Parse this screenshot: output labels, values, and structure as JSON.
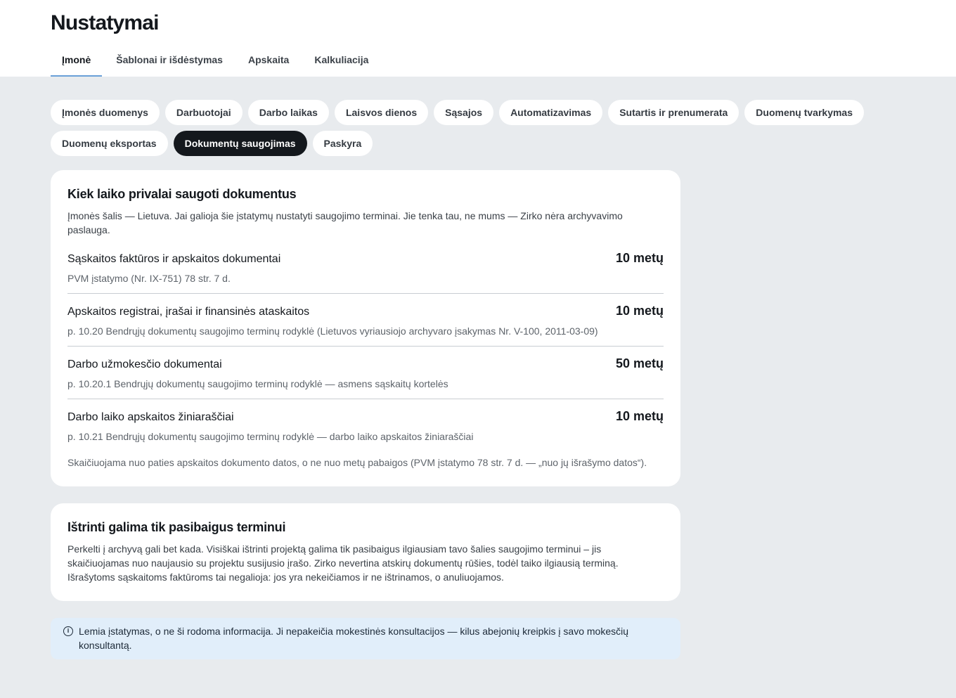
{
  "header": {
    "title": "Nustatymai",
    "tabs": [
      {
        "label": "Įmonė",
        "active": true
      },
      {
        "label": "Šablonai ir išdėstymas",
        "active": false
      },
      {
        "label": "Apskaita",
        "active": false
      },
      {
        "label": "Kalkuliacija",
        "active": false
      }
    ]
  },
  "subnav": {
    "pills": [
      {
        "label": "Įmonės duomenys",
        "active": false
      },
      {
        "label": "Darbuotojai",
        "active": false
      },
      {
        "label": "Darbo laikas",
        "active": false
      },
      {
        "label": "Laisvos dienos",
        "active": false
      },
      {
        "label": "Sąsajos",
        "active": false
      },
      {
        "label": "Automatizavimas",
        "active": false
      },
      {
        "label": "Sutartis ir prenumerata",
        "active": false
      },
      {
        "label": "Duomenų tvarkymas",
        "active": false
      },
      {
        "label": "Duomenų eksportas",
        "active": false
      },
      {
        "label": "Dokumentų saugojimas",
        "active": true
      },
      {
        "label": "Paskyra",
        "active": false
      }
    ]
  },
  "retention": {
    "title": "Kiek laiko privalai saugoti dokumentus",
    "description": "Įmonės šalis — Lietuva. Jai galioja šie įstatymų nustatyti saugojimo terminai. Jie tenka tau, ne mums — Zirko nėra archyvavimo paslauga.",
    "rows": [
      {
        "name": "Sąskaitos faktūros ir apskaitos dokumentai",
        "value": "10 metų",
        "ref": "PVM įstatymo (Nr. IX-751) 78 str. 7 d."
      },
      {
        "name": "Apskaitos registrai, įrašai ir finansinės ataskaitos",
        "value": "10 metų",
        "ref": "p. 10.20 Bendrųjų dokumentų saugojimo terminų rodyklė (Lietuvos vyriausiojo archyvaro įsakymas Nr. V-100, 2011-03-09)"
      },
      {
        "name": "Darbo užmokesčio dokumentai",
        "value": "50 metų",
        "ref": "p. 10.20.1 Bendrųjų dokumentų saugojimo terminų rodyklė — asmens sąskaitų kortelės"
      },
      {
        "name": "Darbo laiko apskaitos žiniaraščiai",
        "value": "10 metų",
        "ref": "p. 10.21 Bendrųjų dokumentų saugojimo terminų rodyklė — darbo laiko apskaitos žiniaraščiai"
      }
    ],
    "note": "Skaičiuojama nuo paties apskaitos dokumento datos, o ne nuo metų pabaigos (PVM įstatymo 78 str. 7 d. — „nuo jų išrašymo datos“)."
  },
  "deletion": {
    "title": "Ištrinti galima tik pasibaigus terminui",
    "description": "Perkelti į archyvą gali bet kada. Visiškai ištrinti projektą galima tik pasibaigus ilgiausiam tavo šalies saugojimo terminui – jis skaičiuojamas nuo naujausio su projektu susijusio įrašo. Zirko nevertina atskirų dokumentų rūšies, todėl taiko ilgiausią terminą. Išrašytoms sąskaitoms faktūroms tai negalioja: jos yra nekeičiamos ir ne ištrinamos, o anuliuojamos."
  },
  "info": {
    "icon": "info-icon",
    "text": "Lemia įstatymas, o ne ši rodoma informacija. Ji nepakeičia mokestinės konsultacijos — kilus abejonių kreipkis į savo mokesčių konsultantą."
  }
}
